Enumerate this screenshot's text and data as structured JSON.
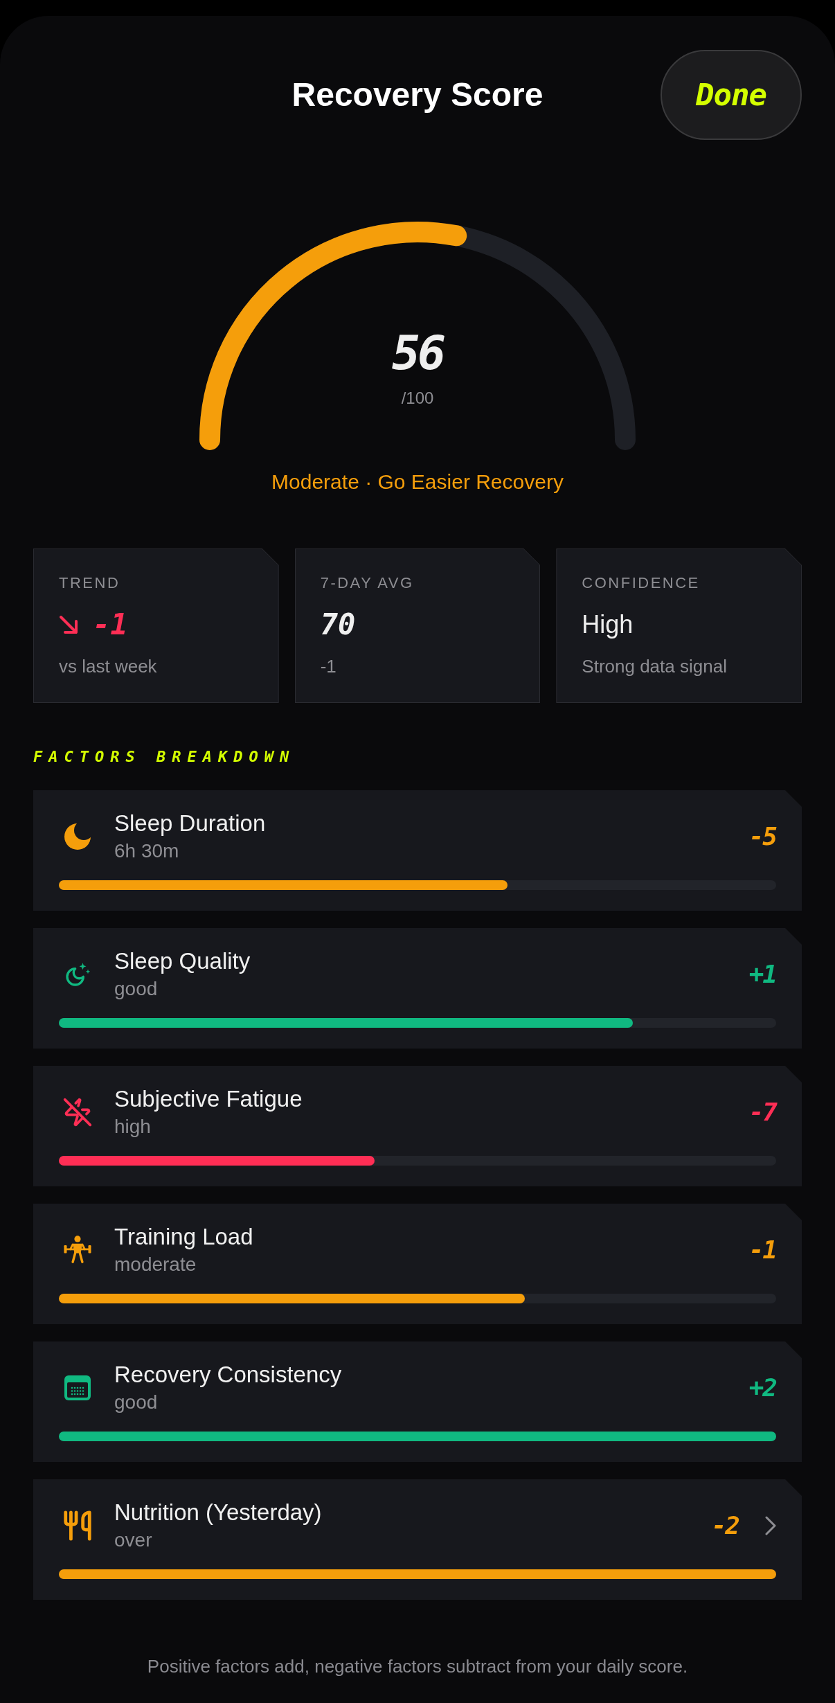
{
  "header": {
    "title": "Recovery Score",
    "done_button": "Done"
  },
  "gauge": {
    "score": "56",
    "max": "/100",
    "level": 0.56,
    "status": "Moderate · Go Easier Recovery"
  },
  "stats": [
    {
      "kind": "trend",
      "label": "TREND",
      "value": "-1",
      "falling": true,
      "caption": "vs last week"
    },
    {
      "kind": "number",
      "label": "7-DAY AVG",
      "value": "70",
      "caption": "-1"
    },
    {
      "kind": "text",
      "label": "CONFIDENCE",
      "value": "High",
      "caption": "Strong data signal"
    }
  ],
  "factors_heading": "FACTORS BREAKDOWN",
  "factors": [
    {
      "name": "Sleep Duration",
      "detail": "6h 30m",
      "impact": "-5",
      "color": "#f59e0b",
      "level": 0.625,
      "has_chevron": false
    },
    {
      "name": "Sleep Quality",
      "detail": "good",
      "impact": "+1",
      "color": "#10b981",
      "level": 0.8,
      "has_chevron": false
    },
    {
      "name": "Subjective Fatigue",
      "detail": "high",
      "impact": "-7",
      "color": "#ff2e55",
      "level": 0.44,
      "has_chevron": false
    },
    {
      "name": "Training Load",
      "detail": "moderate",
      "impact": "-1",
      "color": "#f59e0b",
      "level": 0.65,
      "has_chevron": false
    },
    {
      "name": "Recovery Consistency",
      "detail": "good",
      "impact": "+2",
      "color": "#10b981",
      "level": 1,
      "has_chevron": false
    },
    {
      "name": "Nutrition (Yesterday)",
      "detail": "over",
      "impact": "-2",
      "color": "#f59e0b",
      "level": 1,
      "has_chevron": true
    }
  ],
  "footnote": "Positive factors add, negative factors subtract from your daily score."
}
